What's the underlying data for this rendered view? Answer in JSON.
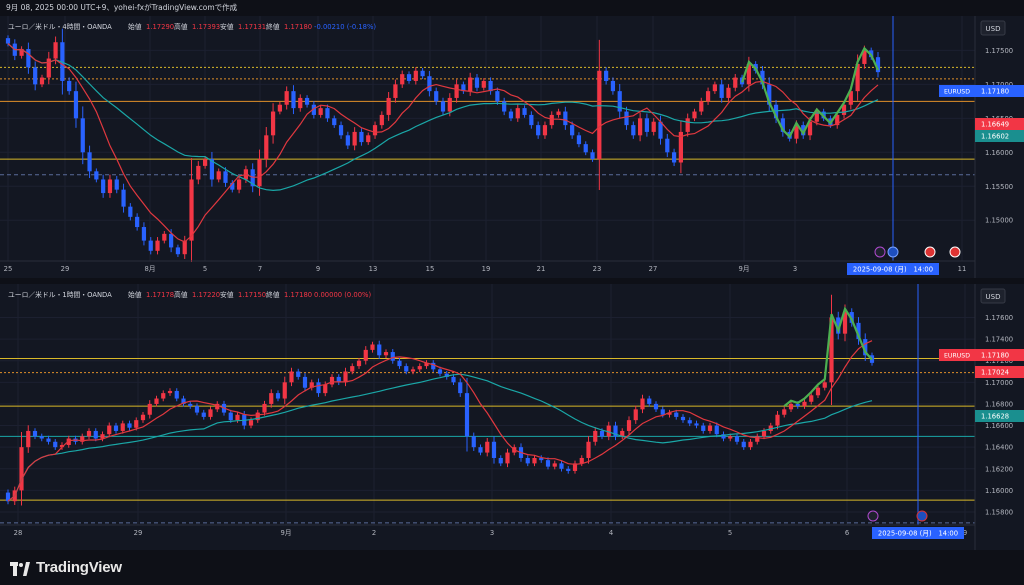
{
  "header": {
    "text": "9月 08, 2025 00:00 UTC+9、yohei-fxがTradingView.comで作成"
  },
  "footer": {
    "brand": "TradingView"
  },
  "colors": {
    "up": "#f23645",
    "down": "#2962ff",
    "ma_short": "#e0383f",
    "ma_long": "#1aa7a7",
    "hline_yellow": "#d9b929",
    "hline_orange": "#e08f2a",
    "drawing": "#4caf50",
    "bg": "#131722"
  },
  "chart_data": [
    {
      "type": "candlestick",
      "legend": {
        "symbol": "ユーロ／米ドル・4時間・OANDA",
        "o_label": "始値",
        "o": "1.17290",
        "h_label": "高値",
        "h": "1.17393",
        "l_label": "安値",
        "l": "1.17131",
        "c_label": "終値",
        "c": "1.17180",
        "chg": "-0.00210 (-0.18%)"
      },
      "currency": "USD",
      "ylim": [
        1.144,
        1.178
      ],
      "y_ticks": [
        "1.17500",
        "1.17000",
        "1.16500",
        "1.16000",
        "1.15500",
        "1.15000"
      ],
      "x_ticks": [
        "25",
        "29",
        "8月",
        "5",
        "7",
        "9",
        "13",
        "15",
        "19",
        "21",
        "23",
        "27",
        "9月",
        "3",
        "11"
      ],
      "price_labels": [
        {
          "text": "EURUSD",
          "value": "1.17180",
          "color": "#2962ff"
        },
        {
          "text": "",
          "value": "1.16649",
          "color": "#f23645"
        },
        {
          "text": "",
          "value": "1.16602",
          "color": "#1a8f8f"
        }
      ],
      "hlines": [
        {
          "price": 1.1725,
          "color": "#d9b929",
          "style": "dotted"
        },
        {
          "price": 1.1708,
          "color": "#e08f2a",
          "style": "dotted"
        },
        {
          "price": 1.1675,
          "color": "#e08f2a",
          "style": "solid"
        },
        {
          "price": 1.159,
          "color": "#d9b929",
          "style": "solid"
        },
        {
          "price": 1.1567,
          "color": "#5a6b9a",
          "style": "dashed"
        }
      ],
      "date_label": "2025-09-08 (月)　14:00",
      "series": [
        {
          "name": "",
          "closes": [
            1.176,
            1.1742,
            1.1752,
            1.1725,
            1.17,
            1.171,
            1.1738,
            1.1762,
            1.1705,
            1.169,
            1.165,
            1.16,
            1.1572,
            1.156,
            1.154,
            1.156,
            1.1545,
            1.152,
            1.1505,
            1.149,
            1.147,
            1.1455,
            1.147,
            1.148,
            1.146,
            1.145,
            1.147,
            1.156,
            1.158,
            1.159,
            1.156,
            1.1572,
            1.1555,
            1.1545,
            1.156,
            1.1575,
            1.155,
            1.159,
            1.1625,
            1.166,
            1.167,
            1.169,
            1.1665,
            1.168,
            1.167,
            1.1655,
            1.1665,
            1.165,
            1.164,
            1.1625,
            1.161,
            1.163,
            1.1615,
            1.1625,
            1.164,
            1.1655,
            1.168,
            1.17,
            1.1715,
            1.1705,
            1.172,
            1.1712,
            1.169,
            1.1675,
            1.166,
            1.168,
            1.17,
            1.169,
            1.171,
            1.1695,
            1.1705,
            1.169,
            1.1675,
            1.166,
            1.165,
            1.1665,
            1.1655,
            1.164,
            1.1625,
            1.164,
            1.1655,
            1.166,
            1.164,
            1.1625,
            1.1612,
            1.16,
            1.159,
            1.172,
            1.1705,
            1.169,
            1.166,
            1.164,
            1.1625,
            1.165,
            1.163,
            1.1645,
            1.162,
            1.16,
            1.1585,
            1.163,
            1.165,
            1.166,
            1.1675,
            1.169,
            1.17,
            1.168,
            1.1695,
            1.171,
            1.17,
            1.173,
            1.172,
            1.17,
            1.167,
            1.165,
            1.163,
            1.162,
            1.164,
            1.1625,
            1.1645,
            1.166,
            1.165,
            1.164,
            1.1655,
            1.167,
            1.169,
            1.173,
            1.175,
            1.174,
            1.1718
          ]
        }
      ]
    },
    {
      "type": "candlestick",
      "legend": {
        "symbol": "ユーロ／米ドル・1時間・OANDA",
        "o_label": "始値",
        "o": "1.17178",
        "h_label": "高値",
        "h": "1.17220",
        "l_label": "安値",
        "l": "1.17150",
        "c_label": "終値",
        "c": "1.17180",
        "chg": "0.00000 (0.00%)"
      },
      "currency": "USD",
      "ylim": [
        1.1568,
        1.1778
      ],
      "y_ticks": [
        "1.17600",
        "1.17400",
        "1.17200",
        "1.17000",
        "1.16800",
        "1.16600",
        "1.16400",
        "1.16200",
        "1.16000",
        "1.15800"
      ],
      "x_ticks": [
        "28",
        "29",
        "9月",
        "2",
        "3",
        "4",
        "5",
        "6",
        "9"
      ],
      "price_labels": [
        {
          "text": "EURUSD",
          "value": "1.17180",
          "color": "#f23645"
        },
        {
          "text": "",
          "value": "1.17024",
          "color": "#f23645"
        },
        {
          "text": "",
          "value": "1.16628",
          "color": "#1a8f8f"
        }
      ],
      "hlines": [
        {
          "price": 1.1722,
          "color": "#d9b929",
          "style": "solid"
        },
        {
          "price": 1.1709,
          "color": "#e08f2a",
          "style": "dotted"
        },
        {
          "price": 1.1678,
          "color": "#d9b929",
          "style": "solid"
        },
        {
          "price": 1.165,
          "color": "#1aa7a7",
          "style": "solid"
        },
        {
          "price": 1.1591,
          "color": "#d9b929",
          "style": "solid"
        },
        {
          "price": 1.157,
          "color": "#5a6b9a",
          "style": "dashed"
        }
      ],
      "date_label": "2025-09-08 (月)　14:00",
      "series": [
        {
          "name": "",
          "closes": [
            1.159,
            1.16,
            1.164,
            1.1655,
            1.165,
            1.1648,
            1.1645,
            1.164,
            1.1642,
            1.1648,
            1.1645,
            1.165,
            1.1655,
            1.1648,
            1.1652,
            1.166,
            1.1655,
            1.1662,
            1.1658,
            1.1665,
            1.167,
            1.168,
            1.1685,
            1.169,
            1.1692,
            1.1685,
            1.168,
            1.1678,
            1.1672,
            1.1668,
            1.1675,
            1.168,
            1.1672,
            1.1665,
            1.167,
            1.166,
            1.1665,
            1.1672,
            1.168,
            1.169,
            1.1685,
            1.17,
            1.171,
            1.1705,
            1.1695,
            1.17,
            1.169,
            1.1698,
            1.1705,
            1.17,
            1.171,
            1.1715,
            1.172,
            1.173,
            1.1735,
            1.1725,
            1.1728,
            1.172,
            1.1715,
            1.171,
            1.1712,
            1.1715,
            1.1718,
            1.1712,
            1.1708,
            1.1705,
            1.17,
            1.169,
            1.165,
            1.164,
            1.1635,
            1.1645,
            1.163,
            1.1625,
            1.1635,
            1.164,
            1.163,
            1.1625,
            1.163,
            1.1628,
            1.1622,
            1.1625,
            1.162,
            1.1618,
            1.1625,
            1.163,
            1.1645,
            1.1655,
            1.165,
            1.166,
            1.165,
            1.1655,
            1.1665,
            1.1675,
            1.1685,
            1.168,
            1.1675,
            1.167,
            1.1672,
            1.1668,
            1.1665,
            1.1662,
            1.166,
            1.1655,
            1.166,
            1.1652,
            1.1648,
            1.165,
            1.1645,
            1.164,
            1.1645,
            1.165,
            1.1655,
            1.166,
            1.167,
            1.1675,
            1.168,
            1.1678,
            1.1682,
            1.1688,
            1.1695,
            1.17,
            1.176,
            1.1745,
            1.1765,
            1.1755,
            1.174,
            1.1725,
            1.1718
          ]
        }
      ]
    }
  ]
}
